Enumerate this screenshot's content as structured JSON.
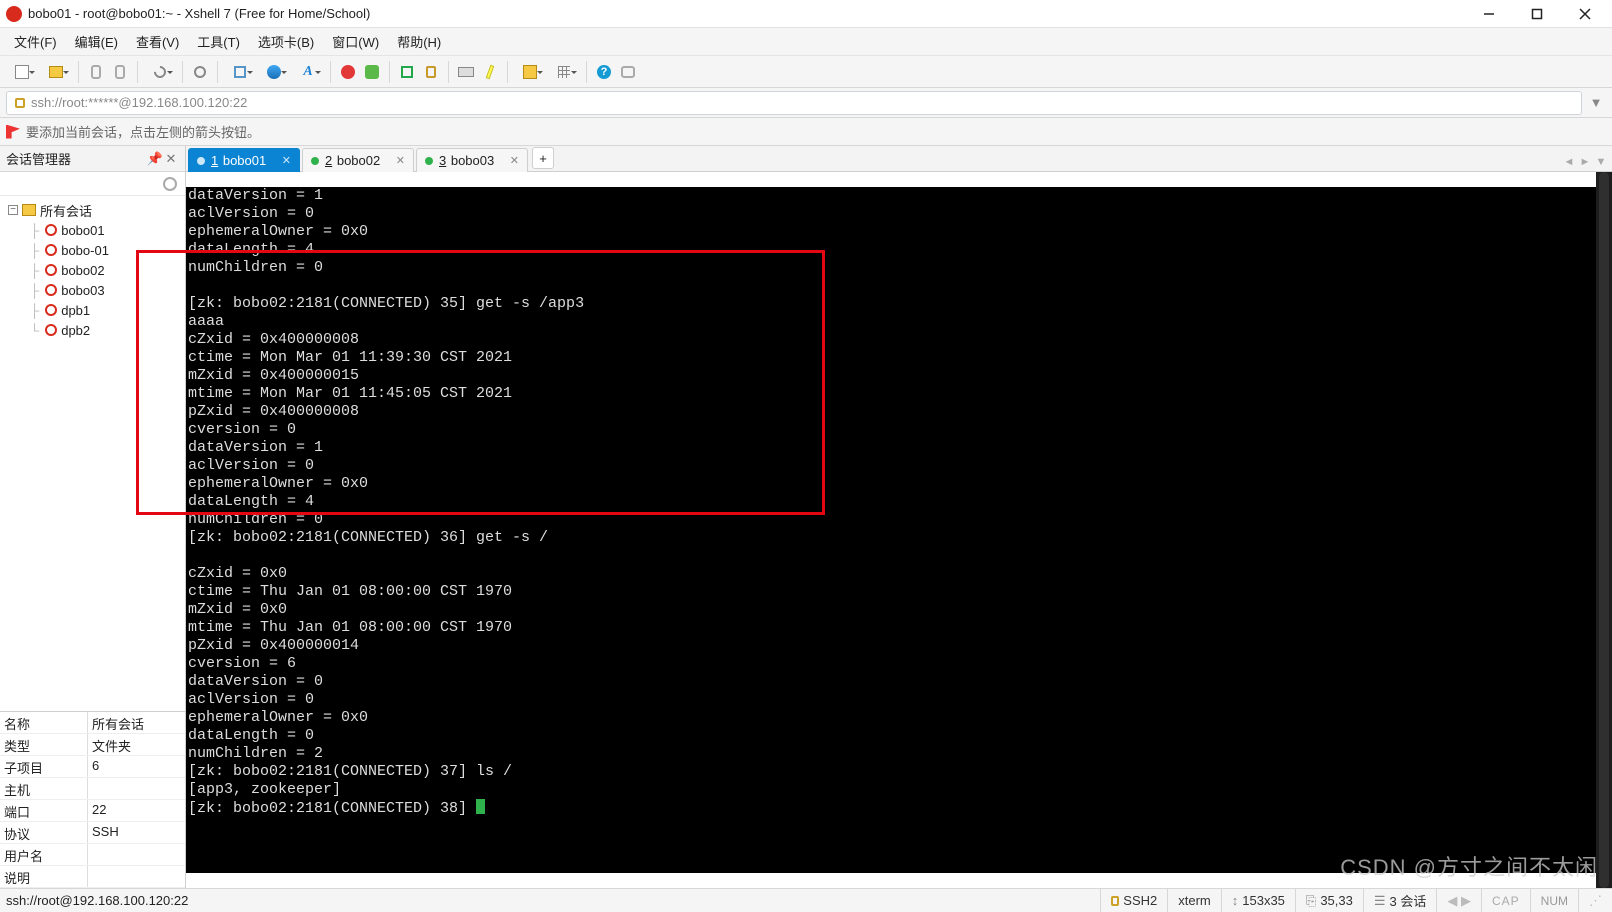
{
  "window": {
    "title": "bobo01 - root@bobo01:~ - Xshell 7 (Free for Home/School)"
  },
  "menu": {
    "file": "文件(F)",
    "edit": "编辑(E)",
    "view": "查看(V)",
    "tools": "工具(T)",
    "tabs": "选项卡(B)",
    "window": "窗口(W)",
    "help": "帮助(H)"
  },
  "address": {
    "text": "ssh://root:******@192.168.100.120:22"
  },
  "hint": {
    "text": "要添加当前会话，点击左侧的箭头按钮。"
  },
  "session_manager": {
    "title": "会话管理器",
    "root": "所有会话",
    "nodes": [
      {
        "label": "bobo01"
      },
      {
        "label": "bobo-01"
      },
      {
        "label": "bobo02"
      },
      {
        "label": "bobo03"
      },
      {
        "label": "dpb1"
      },
      {
        "label": "dpb2"
      }
    ]
  },
  "props": [
    {
      "k": "名称",
      "v": "所有会话"
    },
    {
      "k": "类型",
      "v": "文件夹"
    },
    {
      "k": "子项目",
      "v": "6"
    },
    {
      "k": "主机",
      "v": ""
    },
    {
      "k": "端口",
      "v": "22"
    },
    {
      "k": "协议",
      "v": "SSH"
    },
    {
      "k": "用户名",
      "v": ""
    },
    {
      "k": "说明",
      "v": ""
    }
  ],
  "tabs": [
    {
      "num": "1",
      "label": "bobo01",
      "active": true,
      "color": "blue"
    },
    {
      "num": "2",
      "label": "bobo02",
      "active": false,
      "color": "green"
    },
    {
      "num": "3",
      "label": "bobo03",
      "active": false,
      "color": "green"
    }
  ],
  "terminal_lines": [
    "dataVersion = 1",
    "aclVersion = 0",
    "ephemeralOwner = 0x0",
    "dataLength = 4",
    "numChildren = 0",
    "",
    "[zk: bobo02:2181(CONNECTED) 35] get -s /app3",
    "aaaa",
    "cZxid = 0x400000008",
    "ctime = Mon Mar 01 11:39:30 CST 2021",
    "mZxid = 0x400000015",
    "mtime = Mon Mar 01 11:45:05 CST 2021",
    "pZxid = 0x400000008",
    "cversion = 0",
    "dataVersion = 1",
    "aclVersion = 0",
    "ephemeralOwner = 0x0",
    "dataLength = 4",
    "numChildren = 0",
    "[zk: bobo02:2181(CONNECTED) 36] get -s /",
    "",
    "cZxid = 0x0",
    "ctime = Thu Jan 01 08:00:00 CST 1970",
    "mZxid = 0x0",
    "mtime = Thu Jan 01 08:00:00 CST 1970",
    "pZxid = 0x400000014",
    "cversion = 6",
    "dataVersion = 0",
    "aclVersion = 0",
    "ephemeralOwner = 0x0",
    "dataLength = 0",
    "numChildren = 2",
    "[zk: bobo02:2181(CONNECTED) 37] ls /",
    "[app3, zookeeper]",
    "[zk: bobo02:2181(CONNECTED) 38] "
  ],
  "status": {
    "left": "ssh://root@192.168.100.120:22",
    "proto": "SSH2",
    "term": "xterm",
    "size": "153x35",
    "pos": "35,33",
    "sessions": "3 会话",
    "caps": "CAP",
    "num": "NUM"
  },
  "watermark": "CSDN @方寸之间不太闲",
  "plus": "+"
}
